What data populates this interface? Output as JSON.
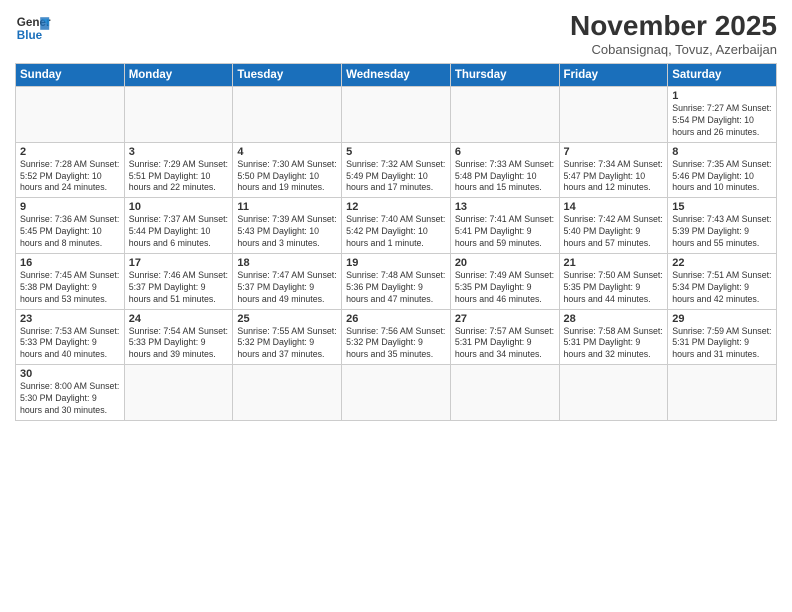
{
  "header": {
    "logo_general": "General",
    "logo_blue": "Blue",
    "month_title": "November 2025",
    "location": "Cobansignaq, Tovuz, Azerbaijan"
  },
  "weekdays": [
    "Sunday",
    "Monday",
    "Tuesday",
    "Wednesday",
    "Thursday",
    "Friday",
    "Saturday"
  ],
  "weeks": [
    [
      {
        "day": "",
        "info": ""
      },
      {
        "day": "",
        "info": ""
      },
      {
        "day": "",
        "info": ""
      },
      {
        "day": "",
        "info": ""
      },
      {
        "day": "",
        "info": ""
      },
      {
        "day": "",
        "info": ""
      },
      {
        "day": "1",
        "info": "Sunrise: 7:27 AM\nSunset: 5:54 PM\nDaylight: 10 hours and 26 minutes."
      }
    ],
    [
      {
        "day": "2",
        "info": "Sunrise: 7:28 AM\nSunset: 5:52 PM\nDaylight: 10 hours and 24 minutes."
      },
      {
        "day": "3",
        "info": "Sunrise: 7:29 AM\nSunset: 5:51 PM\nDaylight: 10 hours and 22 minutes."
      },
      {
        "day": "4",
        "info": "Sunrise: 7:30 AM\nSunset: 5:50 PM\nDaylight: 10 hours and 19 minutes."
      },
      {
        "day": "5",
        "info": "Sunrise: 7:32 AM\nSunset: 5:49 PM\nDaylight: 10 hours and 17 minutes."
      },
      {
        "day": "6",
        "info": "Sunrise: 7:33 AM\nSunset: 5:48 PM\nDaylight: 10 hours and 15 minutes."
      },
      {
        "day": "7",
        "info": "Sunrise: 7:34 AM\nSunset: 5:47 PM\nDaylight: 10 hours and 12 minutes."
      },
      {
        "day": "8",
        "info": "Sunrise: 7:35 AM\nSunset: 5:46 PM\nDaylight: 10 hours and 10 minutes."
      }
    ],
    [
      {
        "day": "9",
        "info": "Sunrise: 7:36 AM\nSunset: 5:45 PM\nDaylight: 10 hours and 8 minutes."
      },
      {
        "day": "10",
        "info": "Sunrise: 7:37 AM\nSunset: 5:44 PM\nDaylight: 10 hours and 6 minutes."
      },
      {
        "day": "11",
        "info": "Sunrise: 7:39 AM\nSunset: 5:43 PM\nDaylight: 10 hours and 3 minutes."
      },
      {
        "day": "12",
        "info": "Sunrise: 7:40 AM\nSunset: 5:42 PM\nDaylight: 10 hours and 1 minute."
      },
      {
        "day": "13",
        "info": "Sunrise: 7:41 AM\nSunset: 5:41 PM\nDaylight: 9 hours and 59 minutes."
      },
      {
        "day": "14",
        "info": "Sunrise: 7:42 AM\nSunset: 5:40 PM\nDaylight: 9 hours and 57 minutes."
      },
      {
        "day": "15",
        "info": "Sunrise: 7:43 AM\nSunset: 5:39 PM\nDaylight: 9 hours and 55 minutes."
      }
    ],
    [
      {
        "day": "16",
        "info": "Sunrise: 7:45 AM\nSunset: 5:38 PM\nDaylight: 9 hours and 53 minutes."
      },
      {
        "day": "17",
        "info": "Sunrise: 7:46 AM\nSunset: 5:37 PM\nDaylight: 9 hours and 51 minutes."
      },
      {
        "day": "18",
        "info": "Sunrise: 7:47 AM\nSunset: 5:37 PM\nDaylight: 9 hours and 49 minutes."
      },
      {
        "day": "19",
        "info": "Sunrise: 7:48 AM\nSunset: 5:36 PM\nDaylight: 9 hours and 47 minutes."
      },
      {
        "day": "20",
        "info": "Sunrise: 7:49 AM\nSunset: 5:35 PM\nDaylight: 9 hours and 46 minutes."
      },
      {
        "day": "21",
        "info": "Sunrise: 7:50 AM\nSunset: 5:35 PM\nDaylight: 9 hours and 44 minutes."
      },
      {
        "day": "22",
        "info": "Sunrise: 7:51 AM\nSunset: 5:34 PM\nDaylight: 9 hours and 42 minutes."
      }
    ],
    [
      {
        "day": "23",
        "info": "Sunrise: 7:53 AM\nSunset: 5:33 PM\nDaylight: 9 hours and 40 minutes."
      },
      {
        "day": "24",
        "info": "Sunrise: 7:54 AM\nSunset: 5:33 PM\nDaylight: 9 hours and 39 minutes."
      },
      {
        "day": "25",
        "info": "Sunrise: 7:55 AM\nSunset: 5:32 PM\nDaylight: 9 hours and 37 minutes."
      },
      {
        "day": "26",
        "info": "Sunrise: 7:56 AM\nSunset: 5:32 PM\nDaylight: 9 hours and 35 minutes."
      },
      {
        "day": "27",
        "info": "Sunrise: 7:57 AM\nSunset: 5:31 PM\nDaylight: 9 hours and 34 minutes."
      },
      {
        "day": "28",
        "info": "Sunrise: 7:58 AM\nSunset: 5:31 PM\nDaylight: 9 hours and 32 minutes."
      },
      {
        "day": "29",
        "info": "Sunrise: 7:59 AM\nSunset: 5:31 PM\nDaylight: 9 hours and 31 minutes."
      }
    ],
    [
      {
        "day": "30",
        "info": "Sunrise: 8:00 AM\nSunset: 5:30 PM\nDaylight: 9 hours and 30 minutes."
      },
      {
        "day": "",
        "info": ""
      },
      {
        "day": "",
        "info": ""
      },
      {
        "day": "",
        "info": ""
      },
      {
        "day": "",
        "info": ""
      },
      {
        "day": "",
        "info": ""
      },
      {
        "day": "",
        "info": ""
      }
    ]
  ]
}
